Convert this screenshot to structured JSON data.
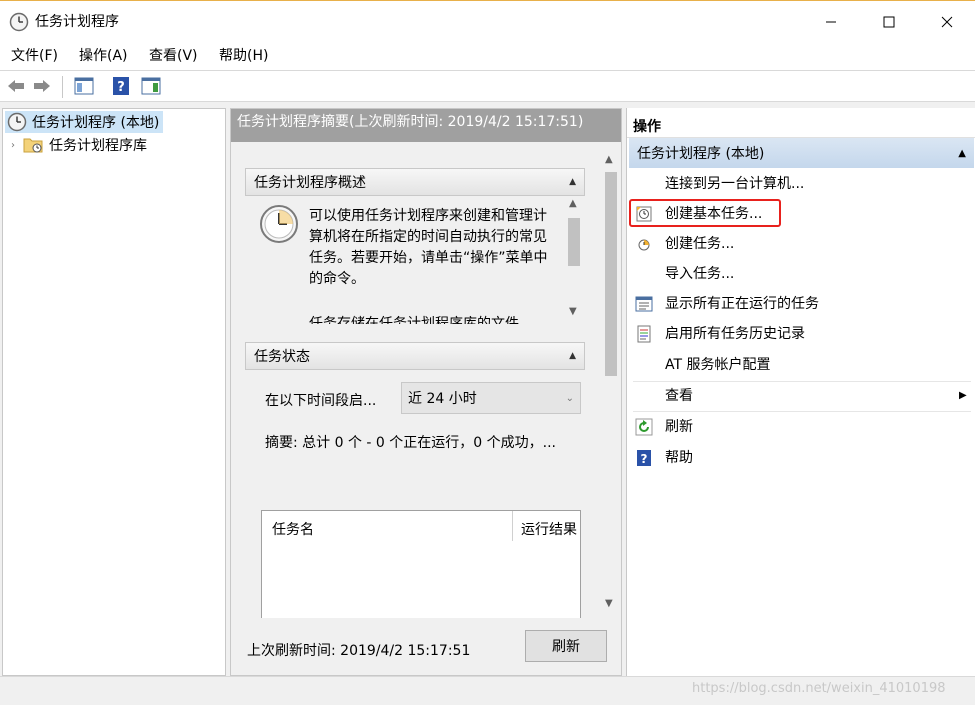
{
  "window": {
    "title": "任务计划程序"
  },
  "menu": {
    "items": [
      "文件(F)",
      "操作(A)",
      "查看(V)",
      "帮助(H)"
    ]
  },
  "tree": {
    "root": "任务计划程序 (本地)",
    "library": "任务计划程序库"
  },
  "center": {
    "header": "任务计划程序摘要(上次刷新时间: 2019/4/2 15:17:51)",
    "overview_title": "任务计划程序概述",
    "overview_text": "可以使用任务计划程序来创建和管理计算机将在所指定的时间自动执行的常见任务。若要开始，请单击“操作”菜单中的命令。",
    "overview_text2": "任务存储在任务计划程序库的文件",
    "status_title": "任务状态",
    "period_label": "在以下时间段启...",
    "period_value": "近 24 小时",
    "summary": "摘要: 总计 0 个 - 0 个正在运行，0 个成功，...",
    "col_task_name": "任务名",
    "col_run_result": "运行结果",
    "footer_refresh_time": "上次刷新时间: 2019/4/2 15:17:51",
    "refresh_button": "刷新"
  },
  "actions": {
    "header": "操作",
    "group": "任务计划程序 (本地)",
    "items": [
      {
        "label": "连接到另一台计算机..."
      },
      {
        "label": "创建基本任务..."
      },
      {
        "label": "创建任务..."
      },
      {
        "label": "导入任务..."
      },
      {
        "label": "显示所有正在运行的任务"
      },
      {
        "label": "启用所有任务历史记录"
      },
      {
        "label": "AT 服务帐户配置"
      },
      {
        "label": "查看"
      },
      {
        "label": "刷新"
      },
      {
        "label": "帮助"
      }
    ]
  },
  "watermark": "https://blog.csdn.net/weixin_41010198",
  "colors": {
    "highlight": "#e8211d",
    "selection": "#cce4f7",
    "group_header": "#c4d7ec"
  }
}
